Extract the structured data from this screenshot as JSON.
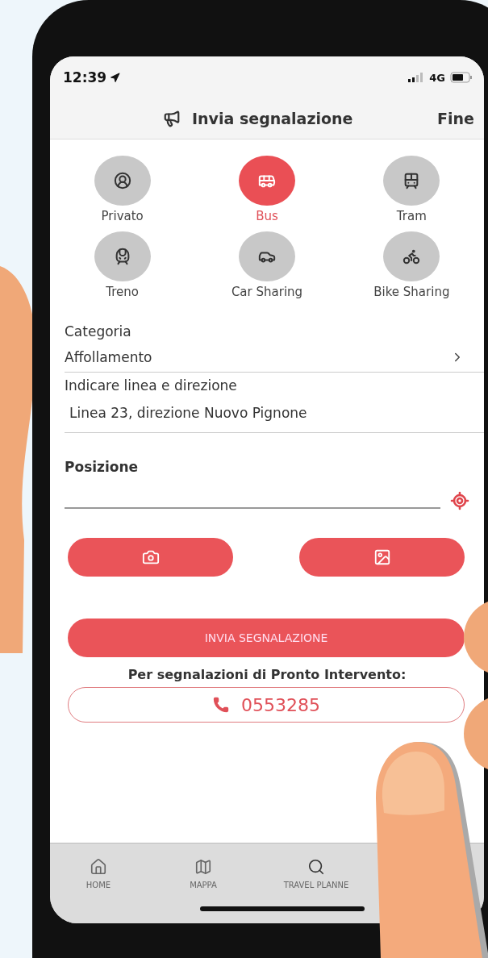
{
  "status_bar": {
    "time": "12:39",
    "network": "4G"
  },
  "header": {
    "title": "Invia segnalazione",
    "done": "Fine"
  },
  "transport_modes": [
    {
      "kind": "private",
      "label": "Privato",
      "selected": false
    },
    {
      "kind": "bus",
      "label": "Bus",
      "selected": true
    },
    {
      "kind": "tram",
      "label": "Tram",
      "selected": false
    },
    {
      "kind": "train",
      "label": "Treno",
      "selected": false
    },
    {
      "kind": "car",
      "label": "Car Sharing",
      "selected": false
    },
    {
      "kind": "bike",
      "label": "Bike Sharing",
      "selected": false
    }
  ],
  "form": {
    "category_label": "Categoria",
    "category_value": "Affollamento",
    "line_label": "Indicare linea e direzione",
    "line_value": "Linea 23, direzione Nuovo Pignone",
    "position_label": "Posizione"
  },
  "send_button": "INVIA SEGNALAZIONE",
  "emergency_note": "Per segnalazioni di Pronto Intervento:",
  "phone_number": "0553285",
  "tab_bar": [
    {
      "kind": "home",
      "label": "HOME"
    },
    {
      "kind": "map",
      "label": "MAPPA"
    },
    {
      "kind": "search",
      "label": "TRAVEL PLANNE"
    }
  ]
}
